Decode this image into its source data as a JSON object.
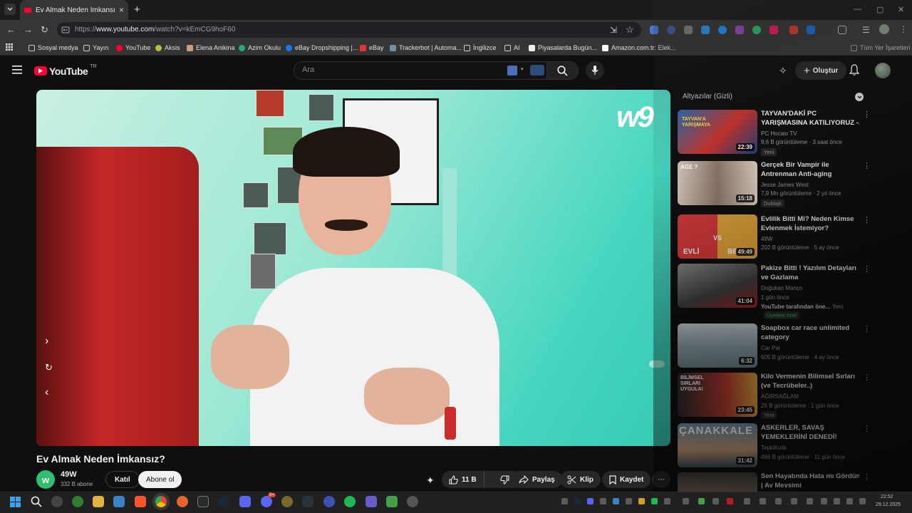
{
  "browser": {
    "tab_title": "Ev Almak Neden İmkansız? - Yo",
    "tab_close": "×",
    "new_tab": "+",
    "url_prefix": "https://",
    "url_host": "www.youtube.com",
    "url_path": "/watch?v=kEmCG9hoF60",
    "bookmarks": [
      "Sosyal medya",
      "Yayın",
      "YouTube",
      "Aksis",
      "Elena Anikina",
      "Azim Okulu",
      "eBay Dropshipping |...",
      "eBay",
      "Trackerbot | Automa...",
      "İngilizce",
      "AI",
      "Piyasalarda Bugün...",
      "Amazon.com.tr: Elek..."
    ],
    "bookmarks_right": "Tüm Yer İşaretleri"
  },
  "youtube": {
    "logo": "YouTube",
    "country": "TR",
    "search_placeholder": "Ara",
    "create_label": "Oluştur"
  },
  "player": {
    "watermark": "w9"
  },
  "video": {
    "title": "Ev Almak Neden İmkansız?",
    "channel": "49W",
    "channel_initial": "w",
    "subscribers": "332 B abone",
    "join": "Katıl",
    "subscribe": "Abone ol",
    "likes": "11 B",
    "share": "Paylaş",
    "clip": "Klip",
    "save": "Kaydet",
    "more": "⋯"
  },
  "sidebar": {
    "subtitles_header": "Altyazılar (Gizli)",
    "recommendations": [
      {
        "title1": "TAYVAN'DAKİ PC",
        "title2": "YARIŞMASINA KATILIYORUZ -...",
        "channel": "PC Hocası TV",
        "meta": "9,6 B görüntüleme · 3 saat önce",
        "badge": "Yeni",
        "duration": "22:39"
      },
      {
        "title1": "Gerçek Bir Vampir ile",
        "title2": "Antrenman Anti-aging",
        "channel": "Jesse James West",
        "meta": "7,9 Mn görüntüleme · 2 yıl önce",
        "badge": "Dublajlı",
        "duration": "15:18"
      },
      {
        "title1": "Evlilik Bitti Mi? Neden Kimse",
        "title2": "Evlenmek İstemiyor?",
        "channel": "49W",
        "meta": "202 B görüntüleme · 5 ay önce",
        "badge": "",
        "duration": "49:49"
      },
      {
        "title1": "Pakize Bitti ! Yazılım Detayları",
        "title2": "ve Gazlama",
        "channel": "Doğukan Manço",
        "meta": "1 gün önce",
        "extra": "YouTube tarafından öne...",
        "extra2": "Yeni",
        "badge": "Üyelere özel",
        "duration": "41:04"
      },
      {
        "title1": "Soapbox car race unlimited",
        "title2": "category",
        "channel": "Car Pal",
        "meta": "605 B görüntüleme · 4 ay önce",
        "badge": "",
        "duration": "6:32"
      },
      {
        "title1": "Kilo Vermenin Bilimsel Sırları",
        "title2": "(ve Tecrübeler..)",
        "channel": "AĞIRSAĞLAM",
        "meta": "25 B görüntüleme · 1 gün önce",
        "badge": "Yeni",
        "duration": "23:45"
      },
      {
        "title1": "ASKERLER, SAVAŞ",
        "title2": "YEMEKLERİNİ DENEDİ!",
        "channel": "TepkiKolik",
        "meta": "466 B görüntüleme · 11 gün önce",
        "badge": "",
        "duration": "31:42"
      },
      {
        "title1": "Sen Hayatında Hata mı Gördün?",
        "title2": "| Av Mevsimi",
        "channel": "",
        "meta": "",
        "badge": "",
        "duration": ""
      }
    ],
    "thumb_labels": {
      "t1": "TAYVAN'A YARIŞMAYA",
      "t2": "AGE ?",
      "t3a": "EVLİ",
      "t3b": "VS",
      "t3c": "BE",
      "t6": "BİLİMSEL SIRLARI UYGULA!",
      "t7": "ÇANAKKALE"
    }
  },
  "taskbar": {
    "time": "22:52",
    "date": "29.12.2025",
    "discord_badge": "9+"
  },
  "colors": {
    "yt_red": "#ff0033",
    "accent_green": "#2fbf6e"
  }
}
